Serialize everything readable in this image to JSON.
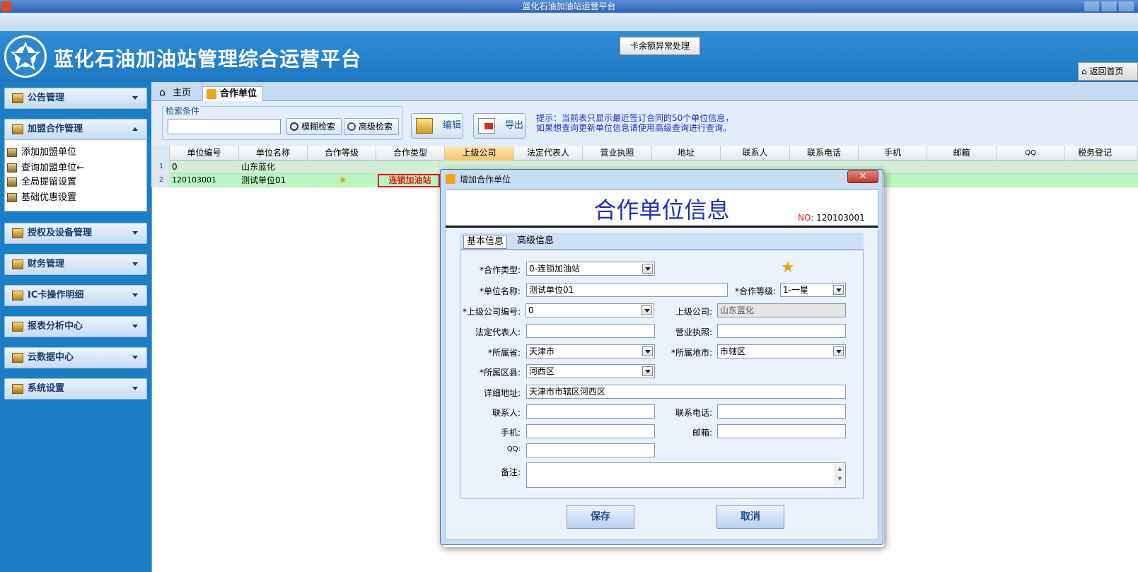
{
  "window": {
    "title": "蓝化石油加油站运营平台"
  },
  "header": {
    "brand": "蓝化石油加油站管理综合运营平台",
    "card_btn": "卡余额异常处理",
    "home_btn": "返回首页"
  },
  "sidebar": {
    "groups": [
      {
        "label": "公告管理"
      },
      {
        "label": "加盟合作管理"
      },
      {
        "label": "授权及设备管理"
      },
      {
        "label": "财务管理"
      },
      {
        "label": "IC卡操作明细"
      },
      {
        "label": "报表分析中心"
      },
      {
        "label": "云数据中心"
      },
      {
        "label": "系统设置"
      }
    ],
    "sub_items": [
      {
        "label": "添加加盟单位"
      },
      {
        "label": "查询加盟单位←"
      },
      {
        "label": "全局提留设置"
      },
      {
        "label": "基础优惠设置"
      }
    ]
  },
  "tabs": [
    {
      "label": "主页"
    },
    {
      "label": "合作单位"
    }
  ],
  "toolbar": {
    "search_legend": "检索条件",
    "search_value": "",
    "fuzzy_btn": "模糊检索",
    "adv_btn": "高级检索",
    "edit_btn": "编辑",
    "export_btn": "导出",
    "hint": "提示：当前表只显示最近签订合同的50个单位信息，如果想查询更新单位信息请使用高级查询进行查询。"
  },
  "grid": {
    "columns": [
      "单位编号",
      "单位名称",
      "合作等级",
      "合作类型",
      "上级公司",
      "法定代表人",
      "营业执照",
      "地址",
      "联系人",
      "联系电话",
      "手机",
      "邮箱",
      "QQ",
      "税务登记"
    ],
    "rows": [
      {
        "n": "1",
        "code": "0",
        "name": "山东蓝化",
        "level": "",
        "type": ""
      },
      {
        "n": "2",
        "code": "120103001",
        "name": "测试单位01",
        "level": "★",
        "type": "连锁加油站"
      }
    ]
  },
  "dialog": {
    "title": "增加合作单位",
    "close": "✕",
    "heading": "合作单位信息",
    "no_label": "NO:",
    "no_value": "120103001",
    "tabs": [
      "基本信息",
      "高级信息"
    ],
    "fields": {
      "type_label": "*合作类型:",
      "type_value": "0-连锁加油站",
      "name_label": "*单位名称:",
      "name_value": "测试单位01",
      "level_label": "*合作等级:",
      "level_value": "1-一星",
      "parent_code_label": "*上级公司编号:",
      "parent_code_value": "0",
      "parent_label": "上级公司:",
      "parent_value": "山东蓝化",
      "legal_label": "法定代表人:",
      "legal_value": "",
      "license_label": "营业执照:",
      "license_value": "",
      "prov_label": "*所属省:",
      "prov_value": "天津市",
      "city_label": "*所属地市:",
      "city_value": "市辖区",
      "district_label": "*所属区县:",
      "district_value": "河西区",
      "addr_label": "详细地址:",
      "addr_value": "天津市市辖区河西区",
      "contact_label": "联系人:",
      "contact_value": "",
      "phone_label": "联系电话:",
      "phone_value": "",
      "mobile_label": "手机:",
      "mobile_value": "",
      "email_label": "邮箱:",
      "email_value": "",
      "qq_label": "QQ:",
      "qq_value": "",
      "note_label": "备注:",
      "note_value": ""
    },
    "save_btn": "保存",
    "cancel_btn": "取消"
  },
  "colors": {
    "header_blue": "#1f78c2",
    "accent_red": "#e01b1b",
    "heading_blue": "#1d2fb5",
    "row_green": "#b9f7c1"
  }
}
